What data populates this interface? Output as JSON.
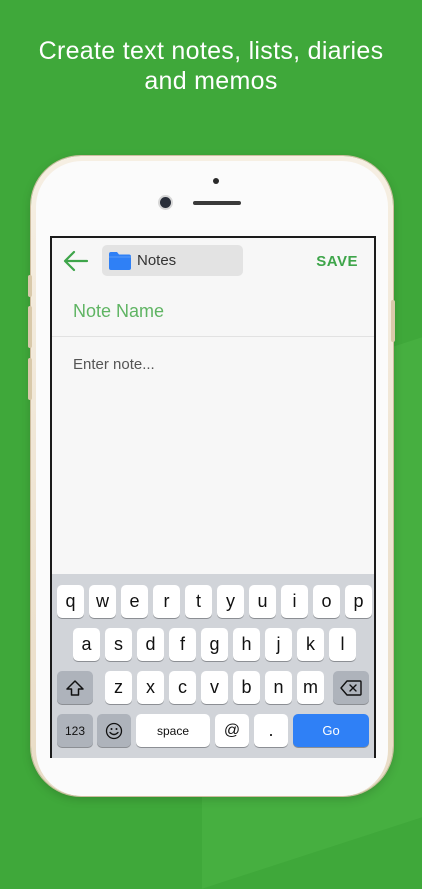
{
  "headline": {
    "line1": "Create text notes, lists, diaries",
    "line2": "and memos"
  },
  "toolbar": {
    "folder_label": "Notes",
    "save_label": "SAVE"
  },
  "editor": {
    "title_placeholder": "Note Name",
    "body_placeholder": "Enter note..."
  },
  "keyboard": {
    "row1": [
      "q",
      "w",
      "e",
      "r",
      "t",
      "y",
      "u",
      "i",
      "o",
      "p"
    ],
    "row2": [
      "a",
      "s",
      "d",
      "f",
      "g",
      "h",
      "j",
      "k",
      "l"
    ],
    "row3": [
      "z",
      "x",
      "c",
      "v",
      "b",
      "n",
      "m"
    ],
    "numbers_label": "123",
    "space_label": "space",
    "at_label": "@",
    "dot_label": ".",
    "go_label": "Go"
  },
  "colors": {
    "background": "#3fa83a",
    "accent": "#3ea54a",
    "go_key": "#2f80f6"
  }
}
